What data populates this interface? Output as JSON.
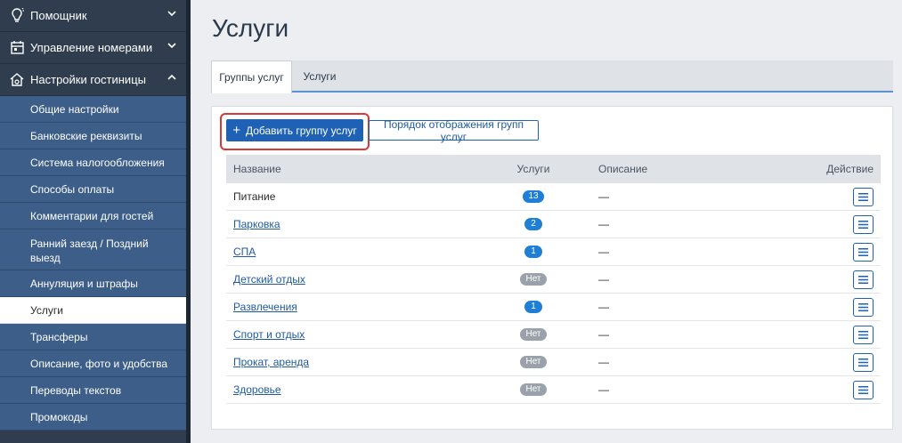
{
  "sidebar": {
    "top_items": [
      {
        "label": "Помощник",
        "icon": "lightbulb-icon"
      },
      {
        "label": "Управление номерами",
        "icon": "calendar-icon"
      },
      {
        "label": "Настройки гостиницы",
        "icon": "home-gear-icon"
      }
    ],
    "sub_items": [
      {
        "label": "Общие настройки"
      },
      {
        "label": "Банковские реквизиты"
      },
      {
        "label": "Система налогообложения"
      },
      {
        "label": "Способы оплаты"
      },
      {
        "label": "Комментарии для гостей"
      },
      {
        "label": "Ранний заезд / Поздний выезд"
      },
      {
        "label": "Аннуляция и штрафы"
      },
      {
        "label": "Услуги"
      },
      {
        "label": "Трансферы"
      },
      {
        "label": "Описание, фото и удобства"
      },
      {
        "label": "Переводы текстов"
      },
      {
        "label": "Промокоды"
      }
    ]
  },
  "page": {
    "title": "Услуги",
    "tabs": [
      {
        "label": "Группы услуг",
        "active": true
      },
      {
        "label": "Услуги",
        "active": false
      }
    ],
    "add_button": "Добавить группу услуг",
    "order_button": "Порядок отображения групп услуг"
  },
  "table": {
    "headers": {
      "name": "Название",
      "services": "Услуги",
      "description": "Описание",
      "action": "Действие"
    },
    "rows": [
      {
        "name": "Питание",
        "link": false,
        "count": "13",
        "badge": "blue",
        "description": "—"
      },
      {
        "name": "Парковка",
        "link": true,
        "count": "2",
        "badge": "blue",
        "description": "—"
      },
      {
        "name": "СПА",
        "link": true,
        "count": "1",
        "badge": "blue",
        "description": "—"
      },
      {
        "name": "Детский отдых",
        "link": true,
        "count": "Нет",
        "badge": "gray",
        "description": "—"
      },
      {
        "name": "Развлечения",
        "link": true,
        "count": "1",
        "badge": "blue",
        "description": "—"
      },
      {
        "name": "Спорт и отдых",
        "link": true,
        "count": "Нет",
        "badge": "gray",
        "description": "—"
      },
      {
        "name": "Прокат, аренда",
        "link": true,
        "count": "Нет",
        "badge": "gray",
        "description": "—"
      },
      {
        "name": "Здоровье",
        "link": true,
        "count": "Нет",
        "badge": "gray",
        "description": "—"
      }
    ]
  },
  "colors": {
    "sidebar_bg": "#2f3d4e",
    "submenu_bg": "#3c5e88",
    "primary": "#1f62b5",
    "highlight": "#d93838",
    "badge_blue": "#1f7fd6",
    "badge_gray": "#9aa1ab"
  }
}
